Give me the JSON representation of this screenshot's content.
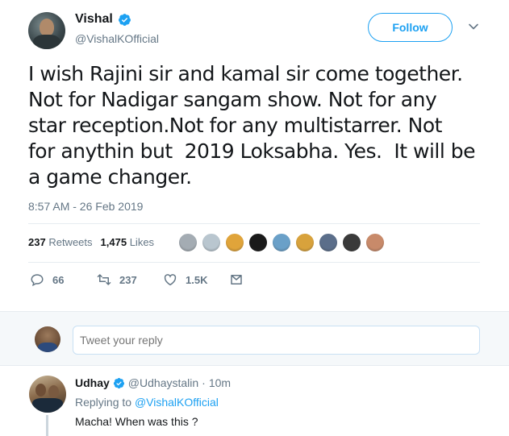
{
  "tweet": {
    "author_name": "Vishal",
    "author_handle": "@VishalKOfficial",
    "follow_label": "Follow",
    "text": "I wish Rajini sir and kamal sir come together.\nNot for Nadigar sangam show. Not for any\nstar reception.Not for any multistarrer. Not\nfor anythin but  2019 Loksabha. Yes.  It will be\na game changer.",
    "timestamp": "8:57 AM - 26 Feb 2019",
    "retweets_count": "237",
    "retweets_label": "Retweets",
    "likes_count": "1,475",
    "likes_label": "Likes",
    "liker_avatar_colors": [
      "#a4acb3",
      "#b9c6cf",
      "#e0a43a",
      "#1a1a1a",
      "#6aa0c8",
      "#d8a23c",
      "#5b6e8a",
      "#3a3a3a",
      "#c88a6a"
    ],
    "actions": {
      "replies": "66",
      "retweets": "237",
      "likes": "1.5K"
    }
  },
  "reply_box": {
    "placeholder": "Tweet your reply"
  },
  "reply_tweet": {
    "author_name": "Udhay",
    "author_handle": "@Udhaystalin",
    "separator": "·",
    "time": "10m",
    "replying_prefix": "Replying to ",
    "replying_to": "@VishalKOfficial",
    "text": "Macha! When was this ?"
  },
  "colors": {
    "accent": "#1da1f2",
    "muted": "#657786",
    "text": "#14171a",
    "divider": "#e6ecf0"
  }
}
